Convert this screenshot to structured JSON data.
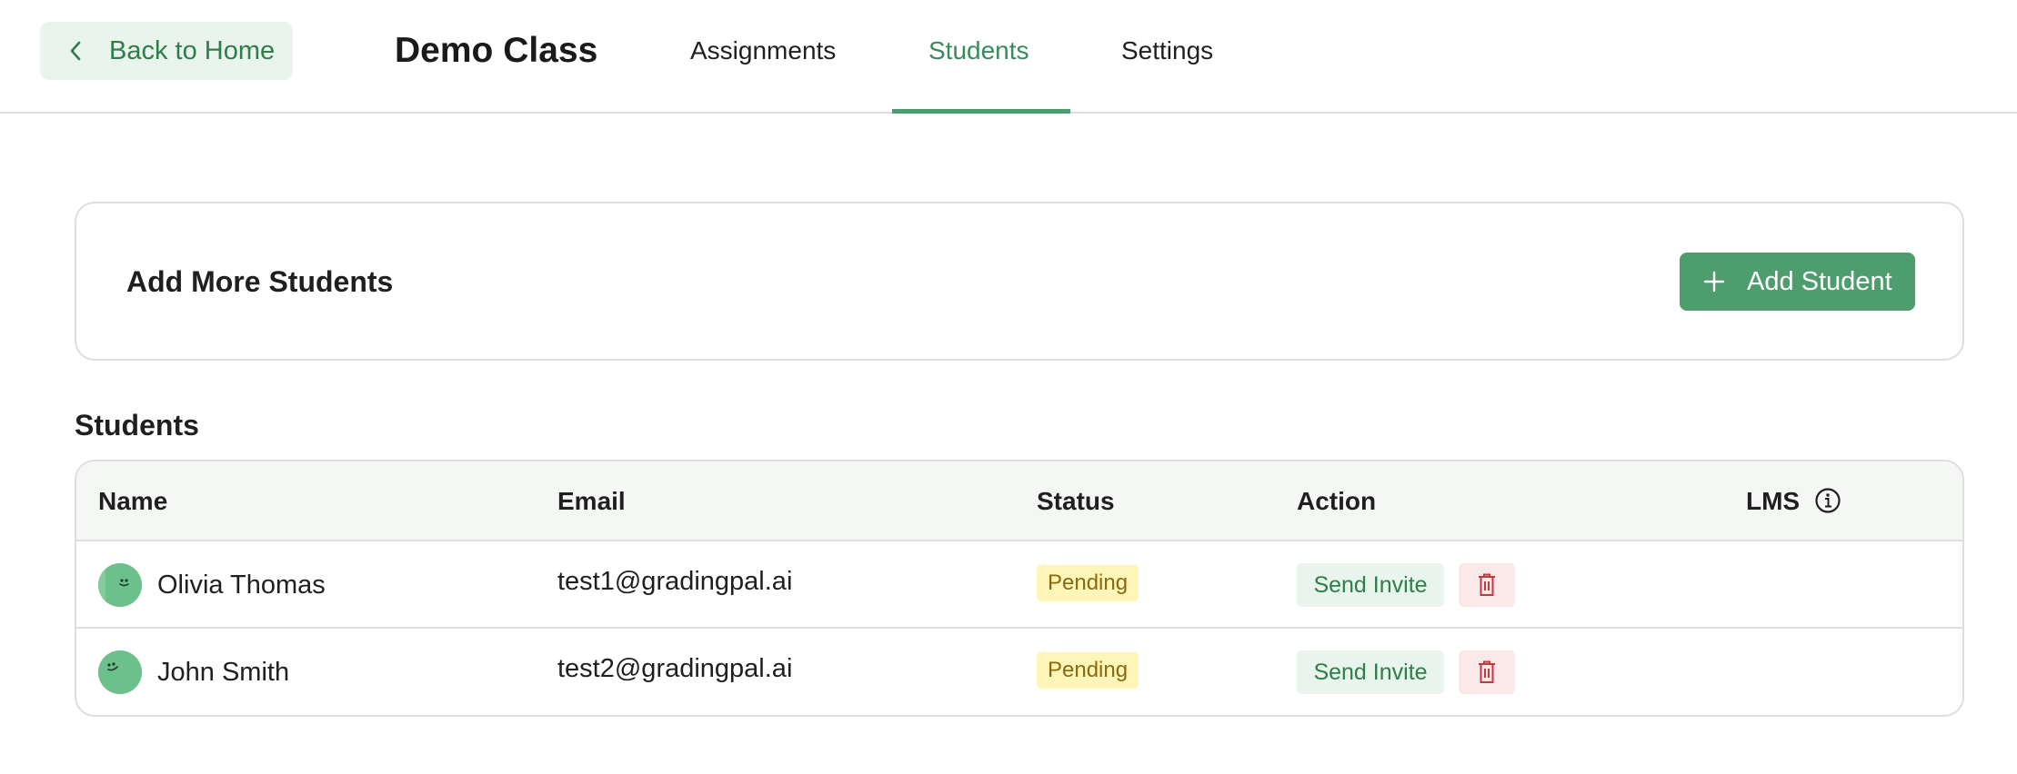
{
  "header": {
    "back_label": "Back to Home",
    "class_title": "Demo Class",
    "tabs": [
      {
        "label": "Assignments",
        "active": false
      },
      {
        "label": "Students",
        "active": true
      },
      {
        "label": "Settings",
        "active": false
      }
    ]
  },
  "add_card": {
    "title": "Add More Students",
    "button_label": "Add Student"
  },
  "students_section": {
    "title": "Students",
    "columns": [
      "Name",
      "Email",
      "Status",
      "Action",
      "LMS"
    ],
    "rows": [
      {
        "name": "Olivia Thomas",
        "email": "test1@gradingpal.ai",
        "status": "Pending",
        "action": "Send Invite"
      },
      {
        "name": "John Smith",
        "email": "test2@gradingpal.ai",
        "status": "Pending",
        "action": "Send Invite"
      }
    ]
  },
  "icons": {
    "back": "chevron-left-icon",
    "add": "plus-icon",
    "delete": "trash-icon",
    "info": "info-icon",
    "avatar": "smiley-avatar-icon"
  },
  "colors": {
    "accent_green": "#4e9d6c",
    "active_tab": "#3a8a5a",
    "pending_bg": "#fdf6b8",
    "pending_text": "#8a6a0e",
    "delete_bg": "#fbe9ea",
    "delete_icon": "#c0393f"
  }
}
